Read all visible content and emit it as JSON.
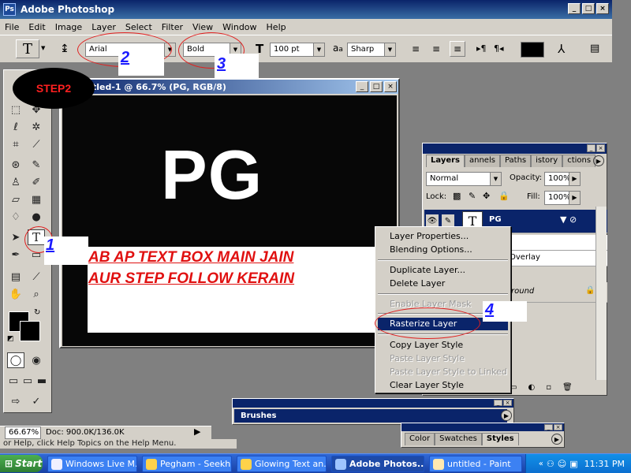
{
  "app": {
    "title": "Adobe Photoshop"
  },
  "menu": [
    "File",
    "Edit",
    "Image",
    "Layer",
    "Select",
    "Filter",
    "View",
    "Window",
    "Help"
  ],
  "options": {
    "font_family": "Arial",
    "font_style": "Bold",
    "font_size": "100 pt",
    "aa_label": "a",
    "antialias": "Sharp",
    "color_swatch": "#000000"
  },
  "document": {
    "title": "tled-1 @ 66.7% (PG, RGB/8)",
    "text": "PG"
  },
  "annotations": {
    "step2": "STEP2",
    "n1": "1",
    "n2": "2",
    "n3": "3",
    "n4": "4",
    "line1": "AB AP TEXT BOX MAIN JAIN",
    "line2": "AUR STEP FOLLOW KERAIN"
  },
  "layers_panel": {
    "tabs": [
      "Layers",
      "annels",
      "Paths",
      "istory",
      "ctions"
    ],
    "blend_mode": "Normal",
    "opacity_label": "Opacity:",
    "opacity": "100%",
    "lock_label": "Lock:",
    "fill_label": "Fill:",
    "fill": "100%",
    "layer_name": "PG",
    "partial_overlay": "Overlay",
    "partial_background": "round"
  },
  "context_menu": [
    {
      "label": "Layer Properties...",
      "disabled": false
    },
    {
      "label": "Blending Options...",
      "disabled": false
    },
    {
      "label": "Duplicate Layer...",
      "disabled": false
    },
    {
      "label": "Delete Layer",
      "disabled": false
    },
    {
      "label": "Enable Layer Mask",
      "disabled": true
    },
    {
      "label": "Rasterize Layer",
      "disabled": false
    },
    {
      "label": "Copy Layer Style",
      "disabled": false
    },
    {
      "label": "Paste Layer Style",
      "disabled": true
    },
    {
      "label": "Paste Layer Style to Linked",
      "disabled": true
    },
    {
      "label": "Clear Layer Style",
      "disabled": false
    }
  ],
  "brushes_panel": {
    "title": "Brushes"
  },
  "styles_panel": {
    "tabs": [
      "Color",
      "Swatches",
      "Styles"
    ]
  },
  "status": {
    "zoom": "66.67%",
    "doc": "Doc: 900.0K/136.0K",
    "help": "or Help, click Help Topics on the Help Menu."
  },
  "taskbar": {
    "start": "Start",
    "tasks": [
      "Windows Live M...",
      "Pegham - Seekh...",
      "Glowing Text an...",
      "Adobe Photos...",
      "untitled - Paint"
    ],
    "clock": "11:31 PM"
  }
}
